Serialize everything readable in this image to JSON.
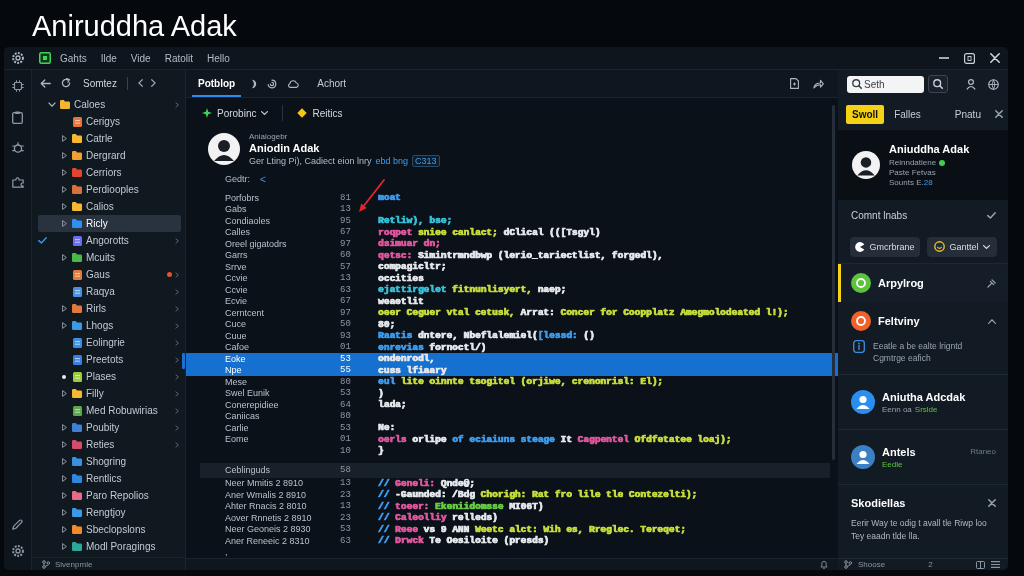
{
  "page_title": "Aniruddha Adak",
  "menu": [
    "Gahts",
    "Ilde",
    "Vide",
    "Ratolit",
    "Hello"
  ],
  "sidebar": {
    "title": "Somtez",
    "tree": [
      {
        "label": "Caloes",
        "kind": "folder",
        "expanded": true,
        "selected": false,
        "color": "#f2b630",
        "checked": false,
        "modified": false,
        "alert": false,
        "more": true,
        "children": [
          {
            "label": "Cerigys",
            "kind": "file",
            "selected": false,
            "color": "#e8743b",
            "checked": false,
            "modified": false,
            "alert": false,
            "more": false
          },
          {
            "label": "Catrle",
            "kind": "folder",
            "expanded": false,
            "selected": false,
            "color": "#f5b82e",
            "checked": false,
            "modified": false,
            "alert": false,
            "more": false
          },
          {
            "label": "Dergrard",
            "kind": "folder",
            "expanded": false,
            "selected": false,
            "color": "#f0a030",
            "checked": false,
            "modified": false,
            "alert": false,
            "more": false
          },
          {
            "label": "Cerriors",
            "kind": "folder",
            "expanded": false,
            "selected": false,
            "color": "#e2442f",
            "checked": false,
            "modified": false,
            "alert": false,
            "more": false
          },
          {
            "label": "Perdiooples",
            "kind": "folder",
            "expanded": false,
            "selected": false,
            "color": "#d9703a",
            "checked": false,
            "modified": false,
            "alert": false,
            "more": false
          },
          {
            "label": "Calios",
            "kind": "folder",
            "expanded": false,
            "selected": false,
            "color": "#f5b82e",
            "checked": false,
            "modified": false,
            "alert": false,
            "more": false
          },
          {
            "label": "Ricly",
            "kind": "folder",
            "expanded": false,
            "selected": true,
            "color": "#2f8ff0",
            "checked": false,
            "modified": false,
            "alert": false,
            "more": false
          },
          {
            "label": "Angorotts",
            "kind": "file",
            "selected": false,
            "color": "#6b6cf0",
            "checked": true,
            "modified": false,
            "alert": false,
            "more": true
          },
          {
            "label": "Mcuits",
            "kind": "folder",
            "expanded": false,
            "selected": false,
            "color": "#4cb84a",
            "checked": false,
            "modified": false,
            "alert": false,
            "more": false
          },
          {
            "label": "Gaus",
            "kind": "file",
            "selected": false,
            "color": "#e07b39",
            "checked": false,
            "modified": false,
            "alert": true,
            "more": true
          },
          {
            "label": "Raqya",
            "kind": "file",
            "selected": false,
            "color": "#4a8fe0",
            "checked": false,
            "modified": false,
            "alert": false,
            "more": true
          },
          {
            "label": "Rirls",
            "kind": "folder",
            "expanded": false,
            "selected": false,
            "color": "#e0793a",
            "checked": false,
            "modified": false,
            "alert": false,
            "more": true
          },
          {
            "label": "Lhogs",
            "kind": "folder",
            "expanded": false,
            "selected": false,
            "color": "#3a9ae8",
            "checked": false,
            "modified": false,
            "alert": false,
            "more": true
          },
          {
            "label": "Eolingrie",
            "kind": "file",
            "selected": false,
            "color": "#3a8fe0",
            "checked": false,
            "modified": false,
            "alert": false,
            "more": true
          },
          {
            "label": "Preetots",
            "kind": "file",
            "selected": false,
            "color": "#3a7fe0",
            "checked": false,
            "modified": false,
            "alert": false,
            "more": true
          },
          {
            "label": "Plases",
            "kind": "file",
            "selected": false,
            "color": "#9ccc3a",
            "checked": false,
            "modified": true,
            "alert": false,
            "more": true
          },
          {
            "label": "Filly",
            "kind": "folder",
            "expanded": false,
            "selected": false,
            "color": "#f5b82e",
            "checked": false,
            "modified": false,
            "alert": false,
            "more": true
          },
          {
            "label": "Med Robuwirias",
            "kind": "file",
            "selected": false,
            "color": "#5aa84a",
            "checked": false,
            "modified": false,
            "alert": false,
            "more": true
          },
          {
            "label": "Poubity",
            "kind": "folder",
            "expanded": false,
            "selected": false,
            "color": "#3f7fd8",
            "checked": false,
            "modified": false,
            "alert": false,
            "more": true
          },
          {
            "label": "Reties",
            "kind": "folder",
            "expanded": false,
            "selected": false,
            "color": "#d84a6a",
            "checked": false,
            "modified": false,
            "alert": false,
            "more": true
          },
          {
            "label": "Shogring",
            "kind": "folder",
            "expanded": false,
            "selected": false,
            "color": "#3a8fe0",
            "checked": false,
            "modified": false,
            "alert": false,
            "more": false
          },
          {
            "label": "Rentlics",
            "kind": "folder",
            "expanded": false,
            "selected": false,
            "color": "#2e86de",
            "checked": false,
            "modified": false,
            "alert": false,
            "more": false
          },
          {
            "label": "Paro Repolios",
            "kind": "folder",
            "expanded": false,
            "selected": false,
            "color": "#e86a8a",
            "checked": false,
            "modified": false,
            "alert": false,
            "more": false
          },
          {
            "label": "Rengtjoy",
            "kind": "folder",
            "expanded": false,
            "selected": false,
            "color": "#3a9ae8",
            "checked": false,
            "modified": false,
            "alert": false,
            "more": false
          },
          {
            "label": "Sbeclopslons",
            "kind": "folder",
            "expanded": false,
            "selected": false,
            "color": "#f08a2a",
            "checked": false,
            "modified": false,
            "alert": false,
            "more": false
          },
          {
            "label": "Modl Poragings",
            "kind": "folder",
            "expanded": false,
            "selected": false,
            "color": "#2aa89a",
            "checked": false,
            "modified": false,
            "alert": false,
            "more": false
          }
        ]
      }
    ],
    "status": "Sivenpmle"
  },
  "editor": {
    "tabs": [
      {
        "label": "Potblop",
        "selected": true
      },
      {
        "label": "Achort",
        "selected": false
      }
    ],
    "toolbar": [
      {
        "label": "Porobinc",
        "kind": "dropdown"
      },
      {
        "label": "Reitics",
        "kind": "button"
      }
    ],
    "profile": {
      "kicker": "Aniaiogebr",
      "name": "Aniodin Adak",
      "description": "Ger Lting Pi), Cadiect eion lnry",
      "link": "ebd bng",
      "tag": "C313"
    },
    "filter": {
      "label": "Gedtr:",
      "toggle": "<"
    },
    "rows": [
      {
        "kind": "line",
        "label": "Porfobrs",
        "number": "81",
        "selected": false,
        "code": [
          {
            "text": "moat",
            "color": "#3b9cf0"
          }
        ]
      },
      {
        "kind": "line",
        "label": "Gabs",
        "number": "13",
        "selected": false
      },
      {
        "kind": "line",
        "label": "Condiaoles",
        "number": "95",
        "selected": false,
        "code": [
          {
            "text": "Retliw), bse;",
            "color": "#36c0d8"
          }
        ]
      },
      {
        "kind": "line",
        "label": "Calles",
        "number": "67",
        "selected": false,
        "code": [
          {
            "text": "roqpet",
            "color": "#e0569e"
          },
          {
            "text": " sniee canlact;",
            "color": "#c5dc3c"
          },
          {
            "text": " dClical (([Tsgyl)",
            "color": "#e4e8ec"
          }
        ]
      },
      {
        "kind": "line",
        "label": "Oreel gigatodrs",
        "number": "97",
        "selected": false,
        "code": [
          {
            "text": "dsimuar dn;",
            "color": "#e0569e"
          }
        ]
      },
      {
        "kind": "line",
        "label": "Garrs",
        "number": "60",
        "selected": false,
        "code": [
          {
            "text": "qetsc:",
            "color": "#e0569e"
          },
          {
            "text": " Simintrmndbwp (lerio_tariectlist, forgedl),",
            "color": "#e4e8ec"
          }
        ]
      },
      {
        "kind": "line",
        "label": "Srrve",
        "number": "57",
        "selected": false,
        "code": [
          {
            "text": "compagicltr;",
            "color": "#e4e8ec"
          }
        ]
      },
      {
        "kind": "line",
        "label": "Ccvie",
        "number": "13",
        "selected": false,
        "code": [
          {
            "text": "occities",
            "color": "#e4e8ec"
          }
        ]
      },
      {
        "kind": "line",
        "label": "Ccvie",
        "number": "63",
        "selected": false,
        "code": [
          {
            "text": "ejattirgelet",
            "color": "#36c0d8"
          },
          {
            "text": " fitnunlisyert,",
            "color": "#c5dc3c"
          },
          {
            "text": " naep;",
            "color": "#e4e8ec"
          }
        ]
      },
      {
        "kind": "line",
        "label": "Ecvie",
        "number": "67",
        "selected": false,
        "code": [
          {
            "text": "weaetlit",
            "color": "#e4e8ec"
          }
        ]
      },
      {
        "kind": "line",
        "label": "Cerntcent",
        "number": "97",
        "selected": false,
        "code": [
          {
            "text": "oeer Ceguer vtal cetusk,",
            "color": "#c5dc3c"
          },
          {
            "text": " Arrat:",
            "color": "#e4e8ec"
          },
          {
            "text": " Concer for Coopplatz Amegmolodeated l!);",
            "color": "#c5dc3c"
          }
        ]
      },
      {
        "kind": "line",
        "label": "Cuce",
        "number": "50",
        "selected": false,
        "code": [
          {
            "text": "80;",
            "color": "#e4e8ec"
          }
        ]
      },
      {
        "kind": "line",
        "label": "Cuue",
        "number": "93",
        "selected": false,
        "code": [
          {
            "text": "Raatis",
            "color": "#3b9cf0"
          },
          {
            "text": " dntere, Nbeflalemiel(",
            "color": "#e4e8ec"
          },
          {
            "text": "[lessd:",
            "color": "#3b9cf0"
          },
          {
            "text": " ()",
            "color": "#e4e8ec"
          }
        ]
      },
      {
        "kind": "line",
        "label": "Cafoe",
        "number": "01",
        "selected": false,
        "code": [
          {
            "text": "enrevias",
            "color": "#3b9cf0"
          },
          {
            "text": " fornoctl/)",
            "color": "#e4e8ec"
          }
        ]
      },
      {
        "kind": "line",
        "label": "Eoke",
        "number": "53",
        "selected": true,
        "code": [
          {
            "text": "ondenrodl,",
            "color": "#e4e8ec"
          }
        ]
      },
      {
        "kind": "line",
        "label": "Npe",
        "number": "55",
        "selected": true,
        "code": [
          {
            "text": "cuss lfiaary",
            "color": "#e4e8ec"
          }
        ]
      },
      {
        "kind": "line",
        "label": "Mese",
        "number": "80",
        "selected": false,
        "code": [
          {
            "text": "eul",
            "color": "#3b9cf0"
          },
          {
            "text": " lite oinnte tsogitel (orjiwe, crenonrisl: El);",
            "color": "#c5dc3c"
          }
        ]
      },
      {
        "kind": "line",
        "label": "Swel Eunik",
        "number": "53",
        "selected": false,
        "code": [
          {
            "text": ")",
            "color": "#e4e8ec"
          }
        ]
      },
      {
        "kind": "line",
        "label": "Conerepidiee",
        "number": "64",
        "selected": false,
        "code": [
          {
            "text": "lada;",
            "color": "#e4e8ec"
          }
        ]
      },
      {
        "kind": "line",
        "label": "Caniicas",
        "number": "80",
        "selected": false
      },
      {
        "kind": "line",
        "label": "Carlie",
        "number": "53",
        "selected": false,
        "code": [
          {
            "text": "Ne:",
            "color": "#e4e8ec"
          }
        ]
      },
      {
        "kind": "line",
        "label": "Eome",
        "number": "01",
        "selected": false,
        "code": [
          {
            "text": "oerls",
            "color": "#e0569e"
          },
          {
            "text": " orlipe",
            "color": "#e4e8ec"
          },
          {
            "text": " of eciaiuns steage",
            "color": "#3b9cf0"
          },
          {
            "text": " It",
            "color": "#e4e8ec"
          },
          {
            "text": " Cagpentel",
            "color": "#e0569e"
          },
          {
            "text": " Ofdfetatee loaj);",
            "color": "#c5dc3c"
          }
        ]
      },
      {
        "kind": "line",
        "number": "10",
        "selected": false,
        "code": [
          {
            "text": "}",
            "color": "#e4e8ec"
          }
        ]
      },
      {
        "kind": "section",
        "label": "Ceblinguds",
        "number": "58",
        "selected": false
      },
      {
        "kind": "line",
        "label": "Neer Mmitis 2 8910",
        "number": "13",
        "selected": false,
        "code": [
          {
            "text": "//",
            "color": "#3b9cf0"
          },
          {
            "text": " Geneli:",
            "color": "#e0569e"
          },
          {
            "text": " Qnde@;",
            "color": "#e4e8ec"
          }
        ]
      },
      {
        "kind": "line",
        "label": "Aner Wmalis 2 8910",
        "number": "23",
        "selected": false,
        "code": [
          {
            "text": "//",
            "color": "#3b9cf0"
          },
          {
            "text": " -Gaunded: /Bdg",
            "color": "#e4e8ec"
          },
          {
            "text": " Chorigh: Rat fro lile tle Contezelti);",
            "color": "#c5dc3c"
          }
        ]
      },
      {
        "kind": "line",
        "label": "Ahter Rnacis 2 8010",
        "number": "13",
        "selected": false,
        "code": [
          {
            "text": "//",
            "color": "#3b9cf0"
          },
          {
            "text": " toeer:",
            "color": "#e0569e"
          },
          {
            "text": " Ekeniidomsse",
            "color": "#66cc44"
          },
          {
            "text": " MI06T)",
            "color": "#e4e8ec"
          }
        ]
      },
      {
        "kind": "line",
        "label": "Aover Rnnetis 2 8910",
        "number": "23",
        "selected": false,
        "code": [
          {
            "text": "//",
            "color": "#3b9cf0"
          },
          {
            "text": " Caleolliy",
            "color": "#e0569e"
          },
          {
            "text": " relleds)",
            "color": "#e4e8ec"
          }
        ]
      },
      {
        "kind": "line",
        "label": "Neer Geoneis 2 8930",
        "number": "53",
        "selected": false,
        "code": [
          {
            "text": "//",
            "color": "#3b9cf0"
          },
          {
            "text": " Reee",
            "color": "#e0569e"
          },
          {
            "text": " vs 9 ANN",
            "color": "#e4e8ec"
          },
          {
            "text": " Weetc alct: Wih es, Rreglec. Tereqet;",
            "color": "#c5dc3c"
          }
        ]
      },
      {
        "kind": "line",
        "label": "Aner Reneeic 2 8310",
        "number": "63",
        "selected": false,
        "code": [
          {
            "text": "//",
            "color": "#3b9cf0"
          },
          {
            "text": " Drwck",
            "color": "#e0569e"
          },
          {
            "text": " Te Oesiloite (presds)",
            "color": "#e4e8ec"
          }
        ]
      },
      {
        "kind": "line",
        "label": ",",
        "selected": false
      }
    ]
  },
  "panel": {
    "search": {
      "placeholder": "Seth"
    },
    "tabs": [
      {
        "label": "Swoll",
        "selected": true
      },
      {
        "label": "Falles",
        "selected": false
      },
      {
        "label": "Pnatu",
        "selected": false
      }
    ],
    "profile": {
      "name": "Aniuddha Adak",
      "status": "Reinndatiene",
      "online": true,
      "detail": "Paste Fetvas",
      "count_label": "Sounts E.",
      "count": "28"
    },
    "section_title": "Comnt lnabs",
    "buttons": [
      {
        "label": "Gmcrbrane",
        "kind": "button"
      },
      {
        "label": "Ganttel",
        "kind": "dropdown"
      }
    ],
    "items": [
      {
        "kind": "app",
        "title": "Arpylrog",
        "color": "#5cc43a",
        "selected": true,
        "pinned": true,
        "expanded": false
      },
      {
        "kind": "app",
        "title": "Feltviny",
        "color": "#f0622a",
        "selected": false,
        "pinned": false,
        "expanded": true,
        "note": "Eeatle a be ealte lrigntd Cgmtrge eafich"
      },
      {
        "kind": "contact",
        "title": "Aniutha Adcdak",
        "color": "#2a8ef0",
        "selected": false,
        "pinned": false,
        "expanded": false,
        "subtitle": "Eenn oa",
        "status": "Srslde"
      },
      {
        "kind": "contact",
        "title": "Antels",
        "color": "#3b7fc4",
        "selected": false,
        "pinned": false,
        "expanded": false,
        "status": "Eedle",
        "meta": "Rtaneo"
      }
    ],
    "card": {
      "title": "Skodiellas",
      "text": "Eerir Way te odig t avall tle Riwp loo Tey eaadn tlde lla."
    },
    "status_bar": {
      "text": "Shoose",
      "count": "2"
    }
  }
}
